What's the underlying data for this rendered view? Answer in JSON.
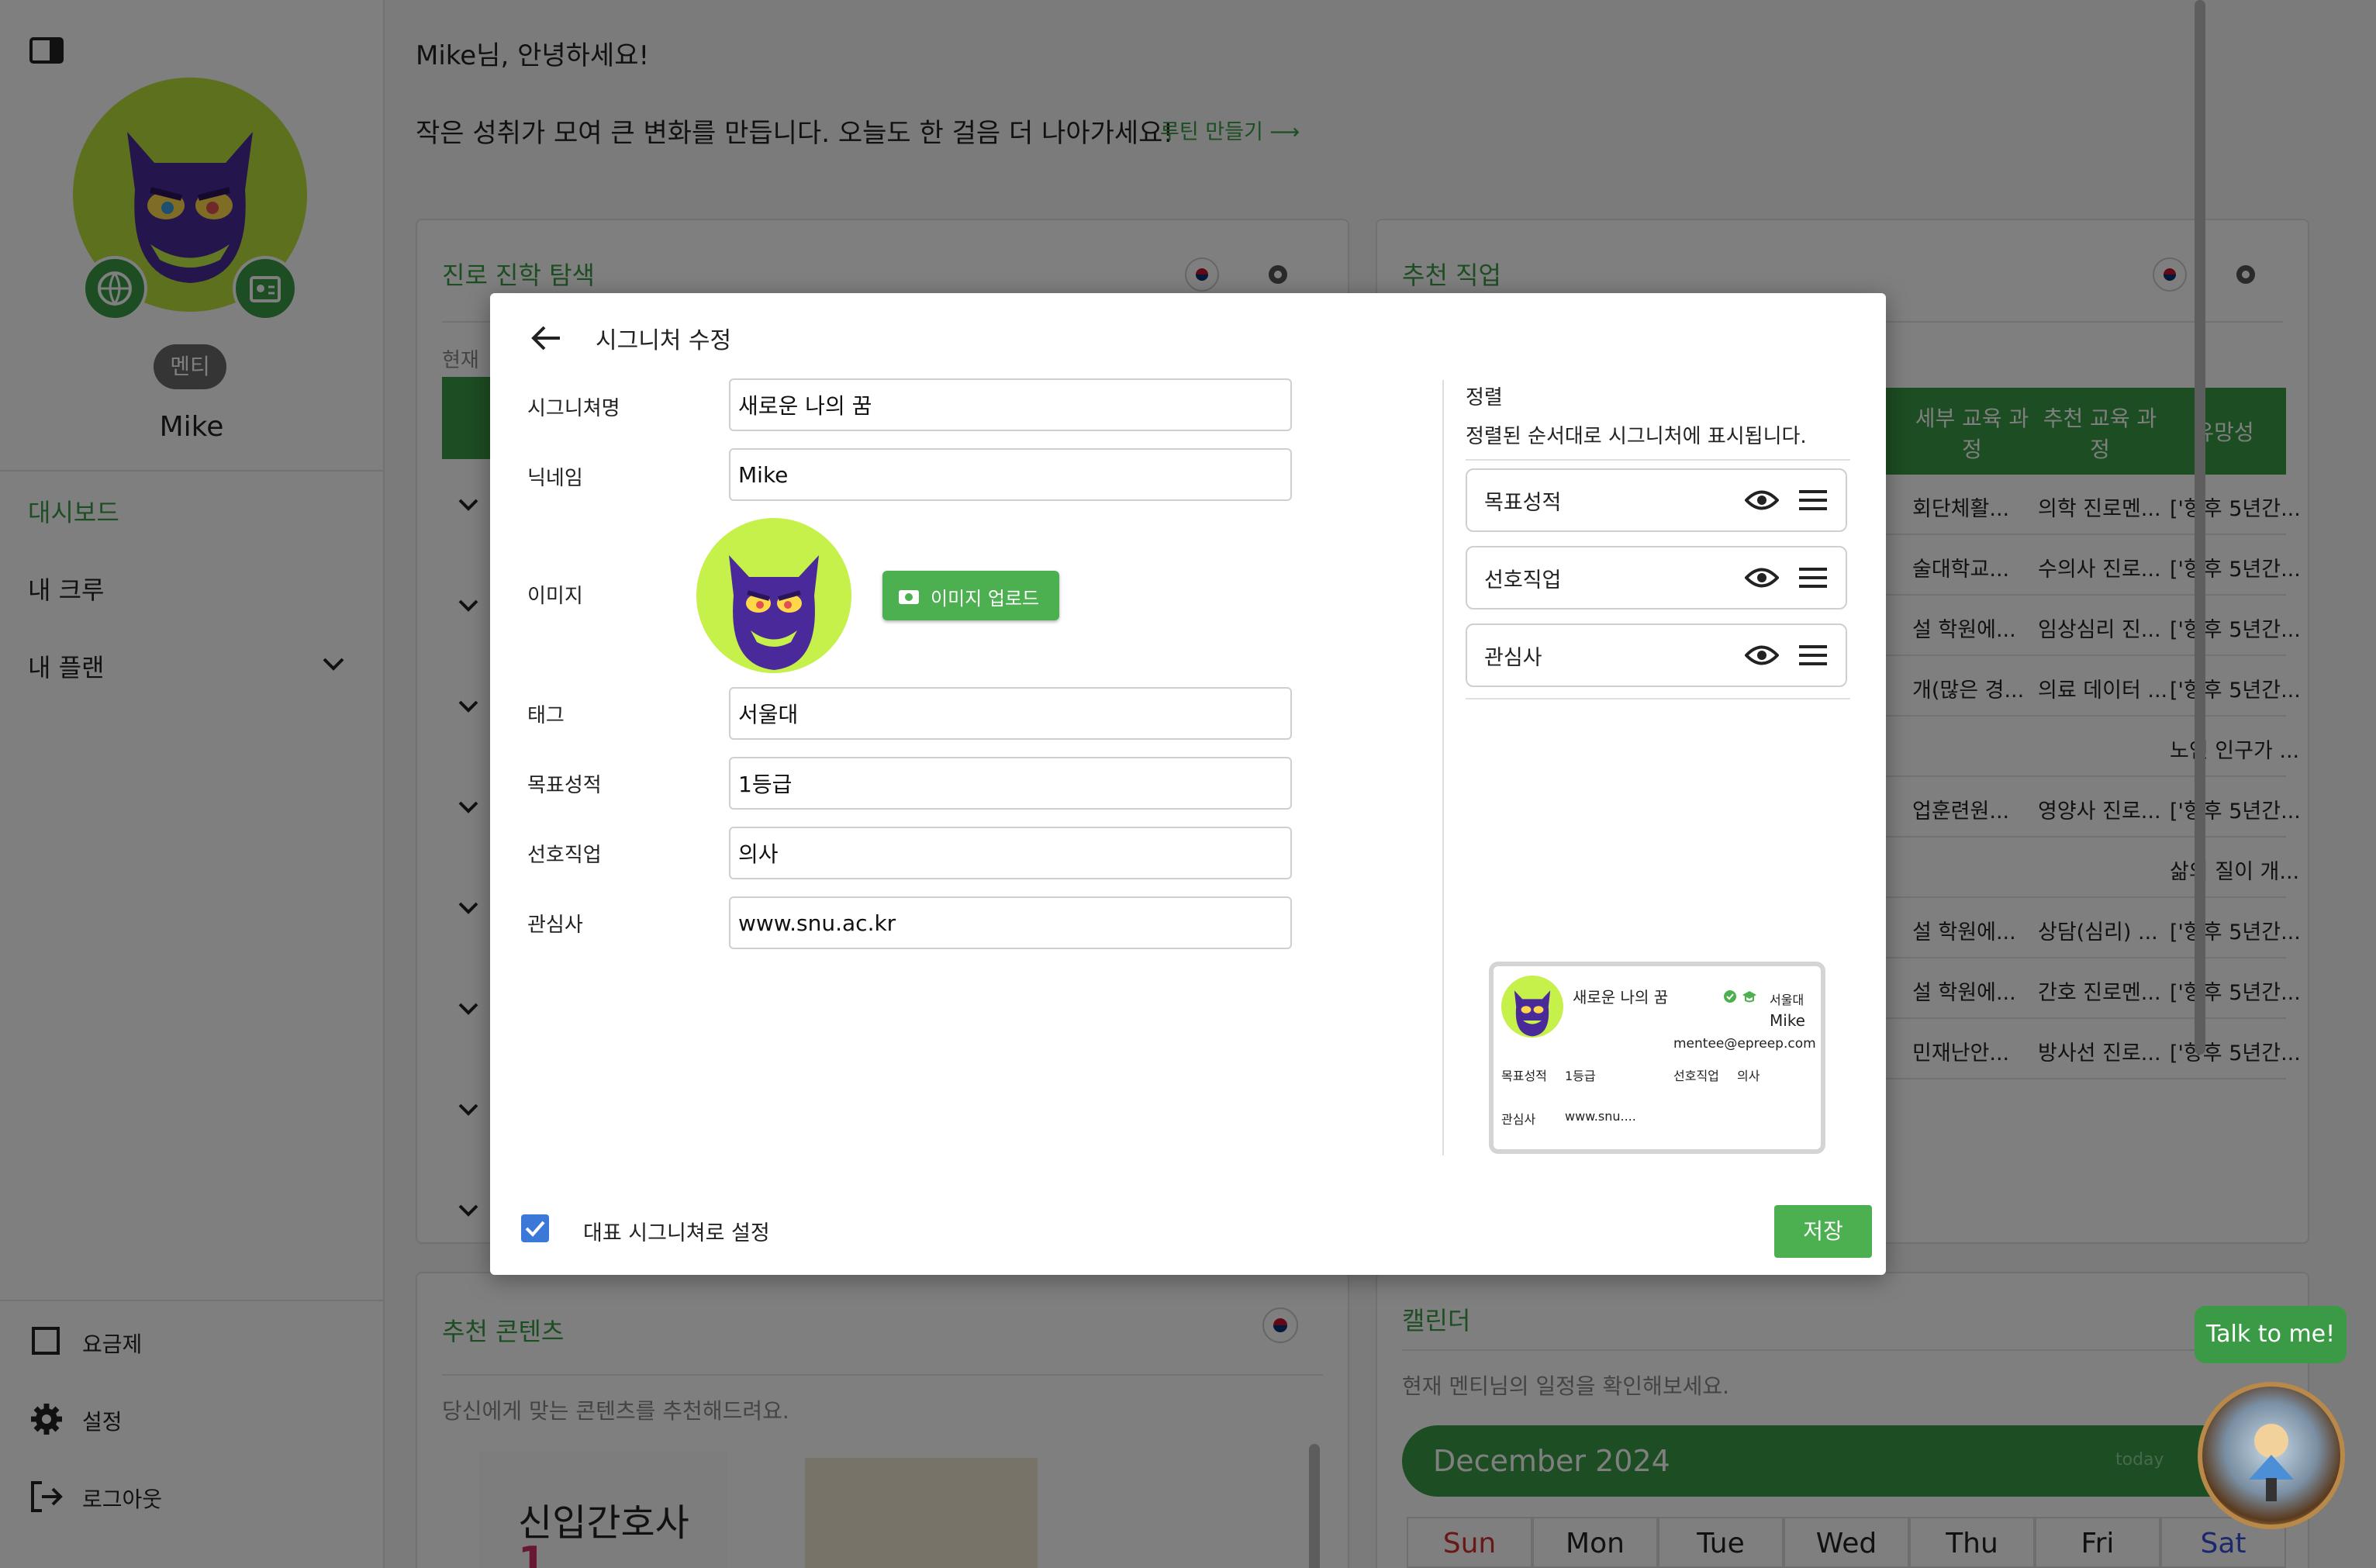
{
  "sidebar": {
    "role_badge": "멘티",
    "user_name": "Mike",
    "nav": [
      {
        "label": "대시보드"
      },
      {
        "label": "내 크루"
      },
      {
        "label": "내 플랜"
      }
    ],
    "bottom": [
      {
        "label": "요금제"
      },
      {
        "label": "설정"
      },
      {
        "label": "로그아웃"
      }
    ]
  },
  "header": {
    "greeting": "Mike님, 안녕하세요!",
    "motto": "작은 성취가 모여 큰 변화를 만듭니다. 오늘도 한 걸음 더 나아가세요!",
    "routine_link": "루틴 만들기 ⟶"
  },
  "cards": {
    "career": {
      "title": "진로 진학 탐색",
      "subtext": "현재"
    },
    "jobs": {
      "title": "추천 직업",
      "columns": [
        "세부 교육 과정",
        "추천 교육 과정",
        "유망성"
      ],
      "rows": [
        [
          "회단체활...",
          "의학 진로멘...",
          "['향후 5년간..."
        ],
        [
          "술대학교...",
          "수의사 진로...",
          "['향후 5년간..."
        ],
        [
          "설 학원에...",
          "임상심리 진...",
          "['향후 5년간..."
        ],
        [
          "개(많은 경...",
          "의료 데이터 ...",
          "['향후 5년간..."
        ],
        [
          "",
          "",
          "노인 인구가 ..."
        ],
        [
          "업훈련원...",
          "영양사 진로...",
          "['향후 5년간..."
        ],
        [
          "",
          "",
          "삶의 질이 개..."
        ],
        [
          "설 학원에...",
          "상담(심리) ...",
          "['향후 5년간..."
        ],
        [
          "설 학원에...",
          "간호 진로멘...",
          "['향후 5년간..."
        ],
        [
          "민재난안...",
          "방사선 진로...",
          "['향후 5년간..."
        ]
      ]
    },
    "contents": {
      "title": "추천 콘텐츠",
      "subtext": "당신에게 맞는 콘텐츠를 추천해드려요.",
      "book1_title": "신입간호사",
      "book1_num": "1"
    },
    "calendar": {
      "title": "캘린더",
      "subtext": "현재 멘티님의 일정을 확인해보세요.",
      "month": "December 2024",
      "today": "today",
      "weekdays": [
        "Sun",
        "Mon",
        "Tue",
        "Wed",
        "Thu",
        "Fri",
        "Sat"
      ]
    }
  },
  "chat": {
    "bubble": "Talk to me!"
  },
  "modal": {
    "title": "시그니처 수정",
    "fields": {
      "signature_name": {
        "label": "시그니쳐명",
        "value": "새로운 나의 꿈"
      },
      "nickname": {
        "label": "닉네임",
        "value": "Mike"
      },
      "image": {
        "label": "이미지",
        "upload_button": "이미지 업로드"
      },
      "tag": {
        "label": "태그",
        "value": "서울대"
      },
      "goal_grade": {
        "label": "목표성적",
        "value": "1등급"
      },
      "preferred_job": {
        "label": "선호직업",
        "value": "의사"
      },
      "interest": {
        "label": "관심사",
        "value": "www.snu.ac.kr"
      }
    },
    "sort": {
      "title": "정렬",
      "desc": "정렬된 순서대로 시그니처에 표시됩니다.",
      "items": [
        "목표성적",
        "선호직업",
        "관심사"
      ]
    },
    "preview": {
      "name": "새로운 나의 꿈",
      "tag": "서울대",
      "nickname": "Mike",
      "email": "mentee@epreep.com",
      "k1": "목표성적",
      "v1": "1등급",
      "k2": "선호직업",
      "v2": "의사",
      "k3": "관심사",
      "v3": "www.snu...."
    },
    "default_checkbox": {
      "label": "대표 시그니쳐로 설정",
      "checked": true
    },
    "save_button": "저장"
  },
  "colors": {
    "accent": "#3a9a45",
    "button": "#4caf50",
    "monster": "#4a2a9a",
    "lime": "#c6f04a",
    "checkbox": "#3b78d8"
  }
}
